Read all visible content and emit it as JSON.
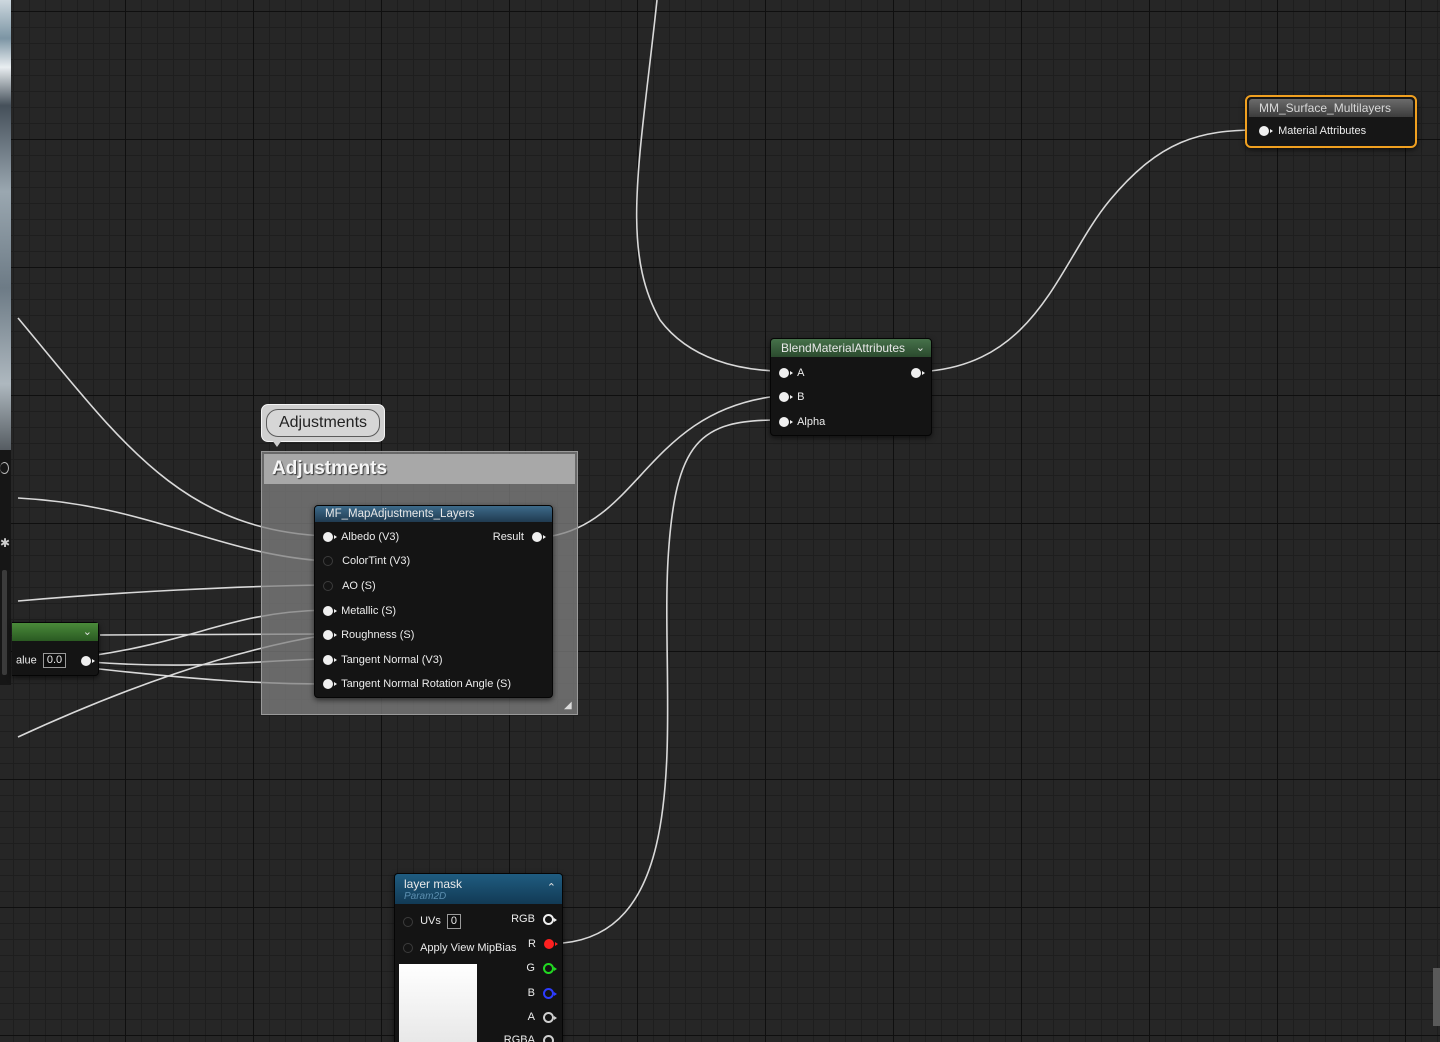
{
  "comment": {
    "bubble_label": "Adjustments",
    "title": "Adjustments"
  },
  "map_adjustments_node": {
    "title": "MF_MapAdjustments_Layers",
    "inputs": [
      "Albedo (V3)",
      "ColorTint (V3)",
      "AO (S)",
      "Metallic (S)",
      "Roughness (S)",
      "Tangent Normal (V3)",
      "Tangent Normal Rotation Angle (S)"
    ],
    "output": "Result"
  },
  "blend_node": {
    "title": "BlendMaterialAttributes",
    "inputs": [
      "A",
      "B",
      "Alpha"
    ]
  },
  "output_node": {
    "title": "MM_Surface_Multilayers",
    "input": "Material Attributes"
  },
  "texture_node": {
    "title": "layer mask",
    "subtitle": "Param2D",
    "uvs_label": "UVs",
    "uvs_value": "0",
    "mipbias_label": "Apply View MipBias",
    "outputs": [
      "RGB",
      "R",
      "G",
      "B",
      "A",
      "RGBA"
    ]
  },
  "left_partial_node": {
    "value_label": "alue",
    "value": "0.0"
  },
  "colors": {
    "canvas": "#262626",
    "wire": "#d9d9d9",
    "output_border": "#f0a020",
    "pin_red": "#ff2020",
    "pin_green": "#22d922",
    "pin_blue": "#2d3cff"
  },
  "icons": [
    "chevron-down-icon",
    "chevron-up-icon",
    "resize-grip-icon"
  ]
}
